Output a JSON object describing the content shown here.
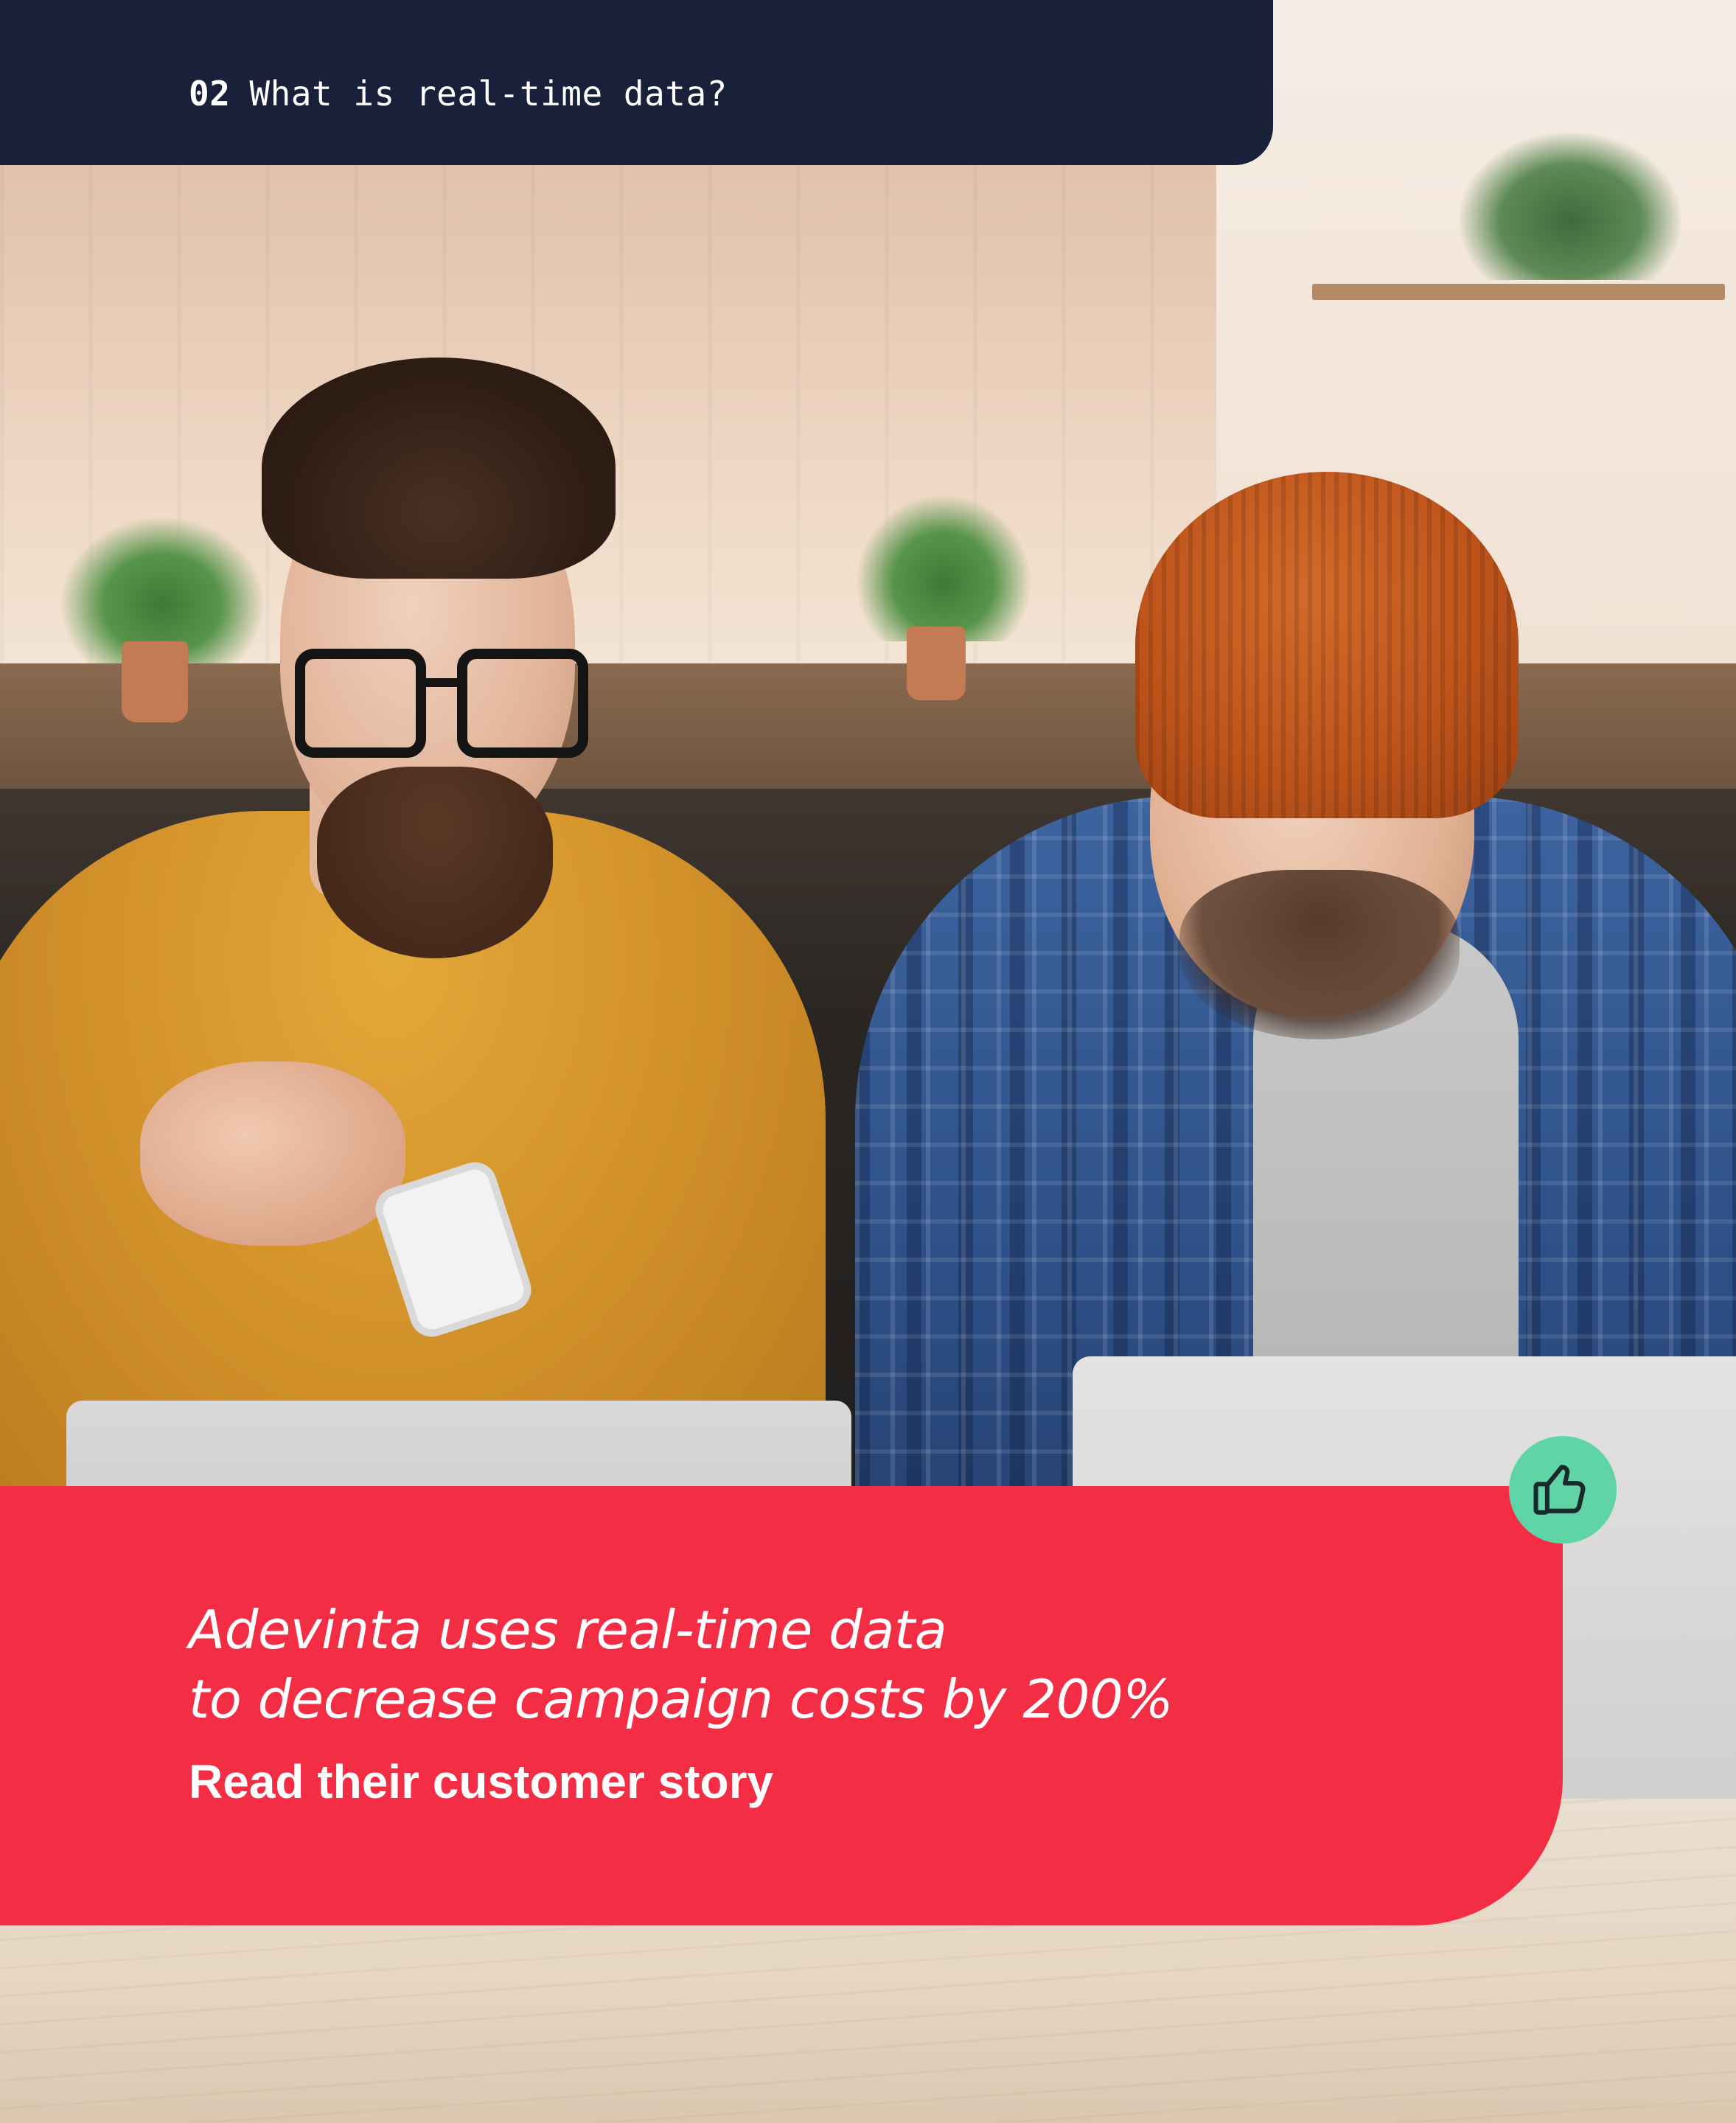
{
  "header": {
    "section_number": "02",
    "section_title": "What is real-time data?"
  },
  "callout": {
    "headline_line1": "Adevinta uses real-time data",
    "headline_line2": "to decrease campaign costs by 200%",
    "cta_label": "Read their customer story",
    "icon": "thumbs-up-icon"
  },
  "colors": {
    "header_bg": "#19213a",
    "callout_bg": "#f22d44",
    "badge_bg": "#5fd4a6",
    "text": "#ffffff"
  }
}
